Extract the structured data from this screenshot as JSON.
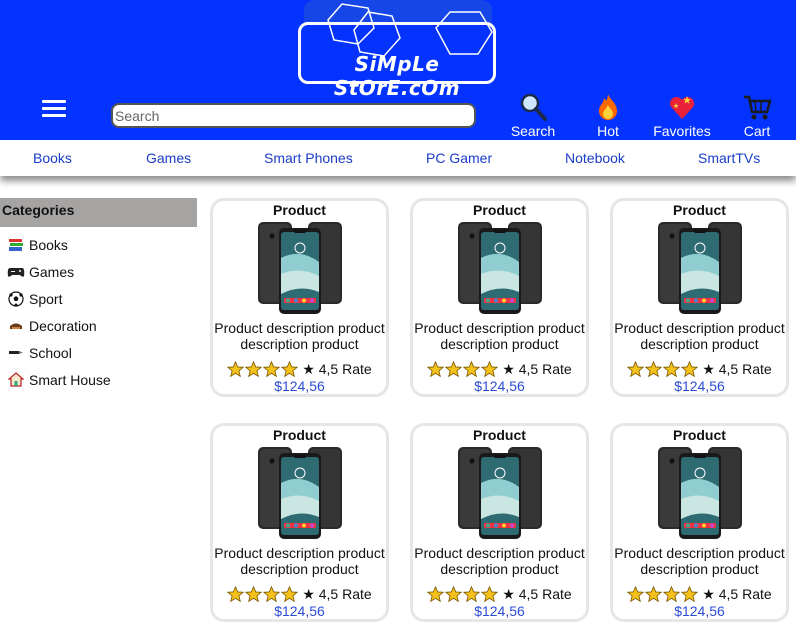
{
  "brand": {
    "logo_text": "SiMpLe StOrE.cOm"
  },
  "search": {
    "placeholder": "Search"
  },
  "header_actions": [
    {
      "label": "Search",
      "icon": "magnifier-icon"
    },
    {
      "label": "Hot",
      "icon": "fire-icon"
    },
    {
      "label": "Favorites",
      "icon": "heart-icon"
    },
    {
      "label": "Cart",
      "icon": "cart-icon"
    }
  ],
  "nav": [
    "Books",
    "Games",
    "Smart Phones",
    "PC Gamer",
    "Notebook",
    "SmartTVs"
  ],
  "sidebar": {
    "title": "Categories",
    "items": [
      {
        "label": "Books",
        "icon": "books-icon"
      },
      {
        "label": "Games",
        "icon": "gamepad-icon"
      },
      {
        "label": "Sport",
        "icon": "soccer-ball-icon"
      },
      {
        "label": "Decoration",
        "icon": "decoration-icon"
      },
      {
        "label": "School",
        "icon": "pen-icon"
      },
      {
        "label": "Smart House",
        "icon": "house-icon"
      }
    ]
  },
  "products": [
    {
      "title": "Product",
      "description": "Product description product description product",
      "rating_stars": 4,
      "rating_text": "★ 4,5 Rate",
      "price": "$124,56"
    },
    {
      "title": "Product",
      "description": "Product description product description product",
      "rating_stars": 4,
      "rating_text": "★ 4,5 Rate",
      "price": "$124,56"
    },
    {
      "title": "Product",
      "description": "Product description product description product",
      "rating_stars": 4,
      "rating_text": "★ 4,5 Rate",
      "price": "$124,56"
    },
    {
      "title": "Product",
      "description": "Product description product description product",
      "rating_stars": 4,
      "rating_text": "★ 4,5 Rate",
      "price": "$124,56"
    },
    {
      "title": "Product",
      "description": "Product description product description product",
      "rating_stars": 4,
      "rating_text": "★ 4,5 Rate",
      "price": "$124,56"
    },
    {
      "title": "Product",
      "description": "Product description product description product",
      "rating_stars": 4,
      "rating_text": "★ 4,5 Rate",
      "price": "$124,56"
    }
  ],
  "colors": {
    "header_bg": "#0433ff",
    "nav_link": "#1a3cc8",
    "price": "#2a4bd7",
    "category_header_bg": "#a6a3a3",
    "star": "#f5c21b"
  }
}
